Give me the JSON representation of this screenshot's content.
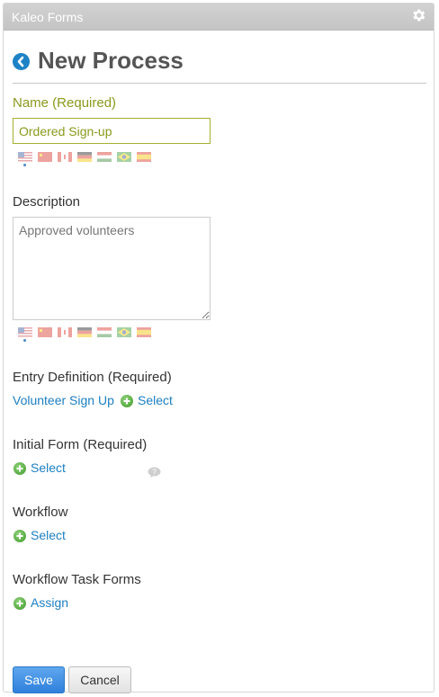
{
  "portlet": {
    "title": "Kaleo Forms",
    "settings_icon": "gear-icon"
  },
  "header": {
    "back_icon": "chevron-left-icon",
    "title": "New Process"
  },
  "name_field": {
    "label": "Name (Required)",
    "value": "Ordered Sign-up"
  },
  "description_field": {
    "label": "Description",
    "value": "Approved volunteers"
  },
  "language_flags": [
    "en_US",
    "zh_CN",
    "ca_ES",
    "de_DE",
    "hu_HU",
    "pt_BR",
    "es_ES"
  ],
  "entry_definition": {
    "label": "Entry Definition (Required)",
    "selected": "Volunteer Sign Up",
    "action": "Select"
  },
  "initial_form": {
    "label": "Initial Form (Required)",
    "help_icon": "help-icon",
    "action": "Select"
  },
  "workflow": {
    "label": "Workflow",
    "action": "Select"
  },
  "workflow_task_forms": {
    "label": "Workflow Task Forms",
    "action": "Assign"
  },
  "buttons": {
    "save": "Save",
    "cancel": "Cancel"
  },
  "colors": {
    "link": "#1c7fc2",
    "required_label": "#8a9a1b",
    "save_button": "#2f7fdc",
    "add_icon": "#3f9b2a"
  }
}
